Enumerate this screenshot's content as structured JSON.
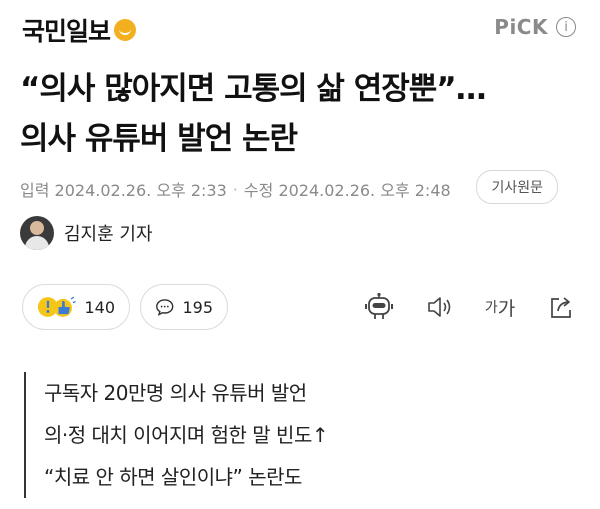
{
  "header": {
    "brand": "국민일보",
    "pick_label": "PiCK",
    "info_symbol": "i"
  },
  "article": {
    "headline_lines": [
      "“의사 많아지면 고통의 삶 연장뿐”…",
      "의사 유튜버 발언 논란"
    ],
    "published_label": "입력",
    "published": "2024.02.26. 오후 2:33",
    "modified_label": "수정",
    "modified": "2024.02.26. 오후 2:48",
    "original_button": "기사원문",
    "reporter": "김지훈 기자",
    "summary_lines": [
      "구독자 20만명 의사 유튜버 발언",
      "의·정 대치 이어지며 험한 말 빈도↑",
      "“치료 안 하면 살인이냐” 논란도"
    ]
  },
  "actions": {
    "reaction_count": "140",
    "comment_count": "195",
    "font_size_label": "가가"
  },
  "colors": {
    "brand_logo": "#f2b01e",
    "muted_text": "#8a8a8a",
    "reaction_yellow": "#f5c518",
    "reaction_blue": "#3a7bd5"
  },
  "icons": [
    "smiley-logo-icon",
    "info-icon",
    "reaction-emoji-icon",
    "comment-icon",
    "robot-icon",
    "speaker-icon",
    "font-size-icon",
    "share-icon"
  ]
}
